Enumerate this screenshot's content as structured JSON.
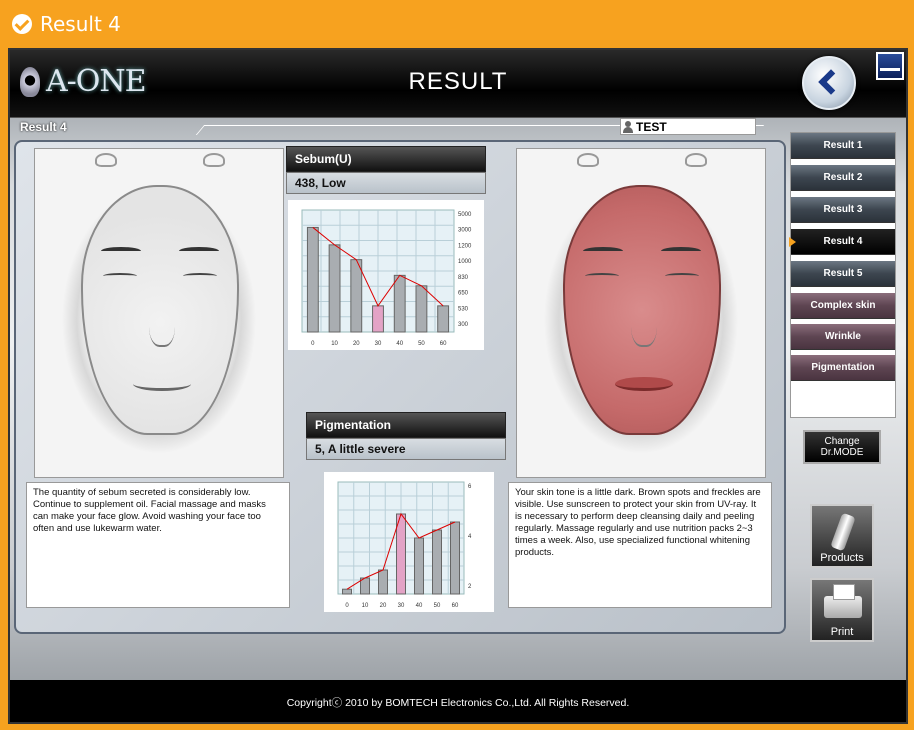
{
  "window": {
    "title": "Result 4"
  },
  "header": {
    "logo_text": "A-ONE",
    "title": "RESULT"
  },
  "subbar": {
    "result_label": "Result 4",
    "user_name": "TEST"
  },
  "sebum": {
    "title": "Sebum(U)",
    "value": "438,  Low"
  },
  "pigmentation": {
    "title": "Pigmentation",
    "value": "5,  A little severe"
  },
  "left_text": "The quantity of sebum secreted is considerably low. Continue to supplement oil. Facial massage and masks can make your face glow. Avoid washing your face too often and use lukewarm water.",
  "right_text": "Your skin tone is a little dark. Brown spots and freckles are visible. Use sunscreen to protect your skin from UV-ray. It is necessary to perform deep cleansing daily and peeling regularly. Massage regularly and use nutrition packs 2~3 times a week. Also, use specialized functional whitening products.",
  "sidebar": {
    "items": [
      {
        "label": "Result 1"
      },
      {
        "label": "Result 2"
      },
      {
        "label": "Result 3"
      },
      {
        "label": "Result 4"
      },
      {
        "label": "Result 5"
      },
      {
        "label": "Complex skin"
      },
      {
        "label": "Wrinkle"
      },
      {
        "label": "Pigmentation"
      }
    ]
  },
  "buttons": {
    "drmode": "Change Dr.MODE",
    "products": "Products",
    "print": "Print"
  },
  "footer": {
    "copyright": "Copyrightⓒ 2010 by BOMTECH Electronics Co.,Ltd. All Rights Reserved."
  },
  "chart_data": [
    {
      "type": "bar",
      "categories": [
        "0",
        "10",
        "20",
        "30",
        "40",
        "50",
        "60"
      ],
      "y_ticks": [
        "5000",
        "3000",
        "1200",
        "1000",
        "830",
        "650",
        "530",
        "300"
      ],
      "values": [
        1200,
        1000,
        830,
        300,
        650,
        530,
        300
      ],
      "highlight_index": 3,
      "title": "",
      "xlabel": "",
      "ylabel": ""
    },
    {
      "type": "bar",
      "categories": [
        "0",
        "10",
        "20",
        "30",
        "40",
        "50",
        "60"
      ],
      "y_ticks": [
        "6",
        "4",
        "2"
      ],
      "values": [
        0.3,
        1,
        1.5,
        5,
        3.5,
        4,
        4.5
      ],
      "highlight_index": 3,
      "ylim": [
        0,
        7
      ],
      "title": "",
      "xlabel": "",
      "ylabel": ""
    }
  ]
}
